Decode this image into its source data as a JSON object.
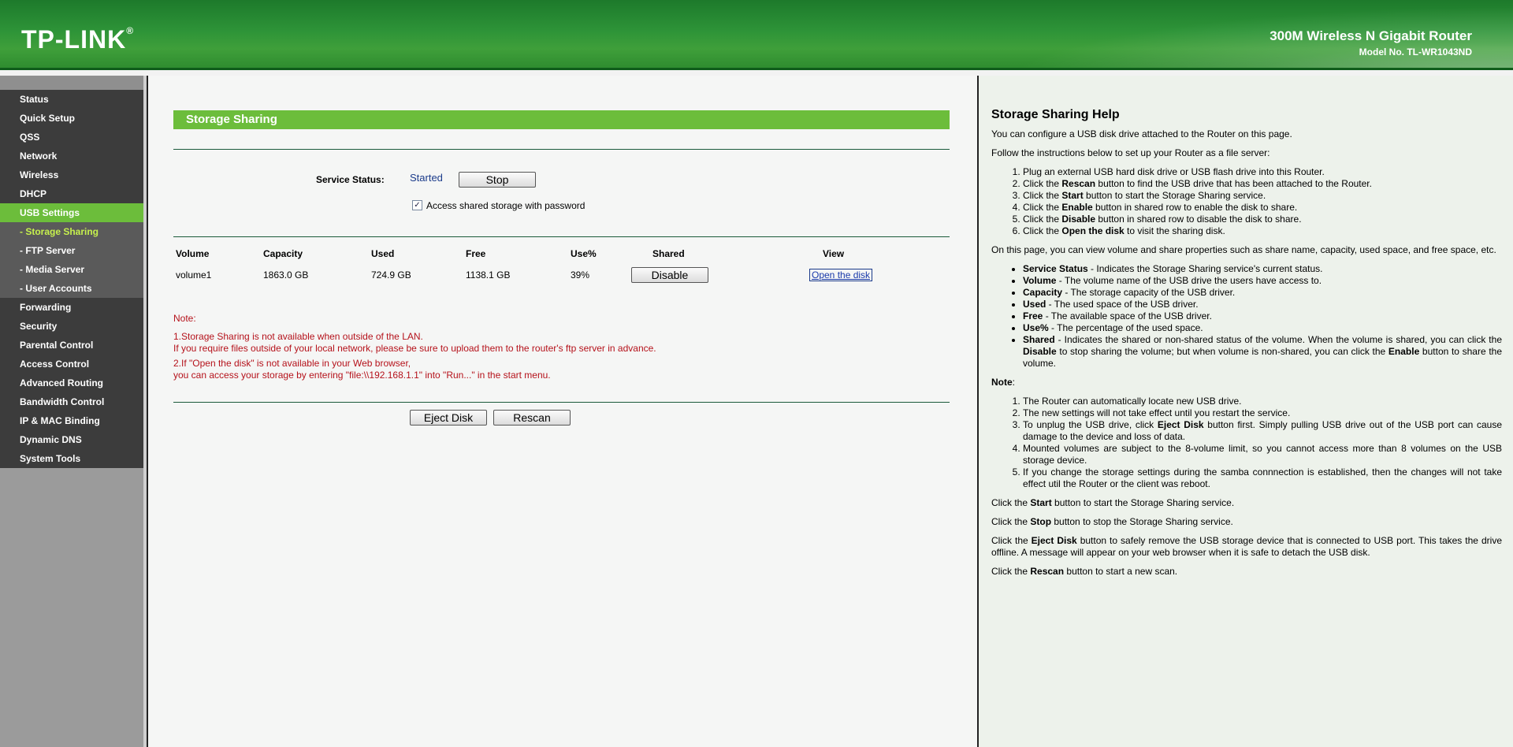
{
  "header": {
    "logo": "TP-LINK",
    "logo_mark": "®",
    "product": "300M Wireless N Gigabit Router",
    "model": "Model No. TL-WR1043ND"
  },
  "sidebar": {
    "items": [
      {
        "label": "Status"
      },
      {
        "label": "Quick Setup"
      },
      {
        "label": "QSS"
      },
      {
        "label": "Network"
      },
      {
        "label": "Wireless"
      },
      {
        "label": "DHCP"
      },
      {
        "label": "USB Settings"
      },
      {
        "label": "- Storage Sharing"
      },
      {
        "label": "- FTP Server"
      },
      {
        "label": "- Media Server"
      },
      {
        "label": "- User Accounts"
      },
      {
        "label": "Forwarding"
      },
      {
        "label": "Security"
      },
      {
        "label": "Parental Control"
      },
      {
        "label": "Access Control"
      },
      {
        "label": "Advanced Routing"
      },
      {
        "label": "Bandwidth Control"
      },
      {
        "label": "IP & MAC Binding"
      },
      {
        "label": "Dynamic DNS"
      },
      {
        "label": "System Tools"
      }
    ]
  },
  "main": {
    "title": "Storage Sharing",
    "service_status_label": "Service Status:",
    "service_status_value": "Started",
    "stop_button": "Stop",
    "password_checkbox_label": "Access shared storage with password",
    "table": {
      "headers": [
        "Volume",
        "Capacity",
        "Used",
        "Free",
        "Use%",
        "Shared",
        "View"
      ],
      "row": {
        "volume": "volume1",
        "capacity": "1863.0 GB",
        "used": "724.9 GB",
        "free": "1138.1 GB",
        "use_pct": "39%",
        "shared_button": "Disable",
        "view_link": "Open the disk"
      }
    },
    "note_title": "Note:",
    "note1_line1": "1.Storage Sharing is not available when outside of the LAN.",
    "note1_line2": "If you require files outside of your local network, please be sure to upload them to the router's ftp server in advance.",
    "note2_line1": "2.If \"Open the disk\" is not available in your Web browser,",
    "note2_line2": "you can access your storage by entering \"file:\\\\192.168.1.1\" into \"Run...\" in the start menu.",
    "eject_button": "Eject Disk",
    "rescan_button": "Rescan"
  },
  "help": {
    "title": "Storage Sharing Help",
    "intro": "You can configure a USB disk drive attached to the Router on this page.",
    "follow": "Follow the instructions below to set up your Router as a file server:",
    "steps": [
      {
        "pre": "Plug an external USB hard disk drive or USB flash drive into this Router.",
        "b": "",
        "post": ""
      },
      {
        "pre": "Click the ",
        "b": "Rescan",
        "post": " button to find the USB drive that has been attached to the Router."
      },
      {
        "pre": "Click the ",
        "b": "Start",
        "post": " button to start the Storage Sharing service."
      },
      {
        "pre": "Click the ",
        "b": "Enable",
        "post": " button in shared row to enable the disk to share."
      },
      {
        "pre": "Click the ",
        "b": "Disable",
        "post": " button in shared row to disable the disk to share."
      },
      {
        "pre": "Click the ",
        "b": "Open the disk",
        "post": " to visit the sharing disk."
      }
    ],
    "page_desc": "On this page, you can view volume and share properties such as share name, capacity, used space, and free space, etc.",
    "bullets": [
      {
        "b": "Service Status",
        "t": " - Indicates the Storage Sharing service's current status."
      },
      {
        "b": "Volume",
        "t": " - The volume name of the USB drive the users have access to."
      },
      {
        "b": "Capacity",
        "t": " - The storage capacity of the USB driver."
      },
      {
        "b": "Used",
        "t": " - The used space of the USB driver."
      },
      {
        "b": "Free",
        "t": " - The available space of the USB driver."
      },
      {
        "b": "Use%",
        "t": " - The percentage of the used space."
      }
    ],
    "shared_bullet": {
      "b1": "Shared",
      "t1": " - Indicates the shared or non-shared status of the volume. When the volume is shared, you can click the ",
      "b2": "Disable",
      "t2": " to stop sharing the volume; but when volume is non-shared, you can click the ",
      "b3": "Enable",
      "t3": " button to share the volume."
    },
    "note_title": "Note",
    "note_colon": ":",
    "notes": [
      {
        "pre": "The Router can automatically locate new USB drive.",
        "b": "",
        "post": ""
      },
      {
        "pre": "The new settings will not take effect until you restart the service.",
        "b": "",
        "post": ""
      },
      {
        "pre": "To unplug the USB drive, click ",
        "b": "Eject Disk",
        "post": " button first. Simply pulling USB drive out of the USB port can cause damage to the device and loss of data."
      },
      {
        "pre": "Mounted volumes are subject to the 8-volume limit, so you cannot access more than 8 volumes on the USB storage device.",
        "b": "",
        "post": ""
      },
      {
        "pre": "If you change the storage settings during the samba connnection is established, then the changes will not take effect util the Router or the client was reboot.",
        "b": "",
        "post": ""
      }
    ],
    "start_para": {
      "pre": "Click the ",
      "b": "Start",
      "post": " button to start the Storage Sharing service."
    },
    "stop_para": {
      "pre": "Click the ",
      "b": "Stop",
      "post": " button to stop the Storage Sharing service."
    },
    "eject_para": {
      "pre": "Click the ",
      "b": "Eject Disk",
      "post": " button to safely remove the USB storage device that is connected to USB port. This takes the drive offline. A message will appear on your web browser when it is safe to detach the USB disk."
    },
    "rescan_para": {
      "pre": "Click the ",
      "b": "Rescan",
      "post": " button to start a new scan."
    }
  },
  "colors": {
    "accent_green": "#6cbd3b",
    "nav_dark": "#3c3c3c",
    "nav_sub": "#5a5a5a",
    "note_red": "#b5121b",
    "status_blue": "#1a3a8a"
  }
}
